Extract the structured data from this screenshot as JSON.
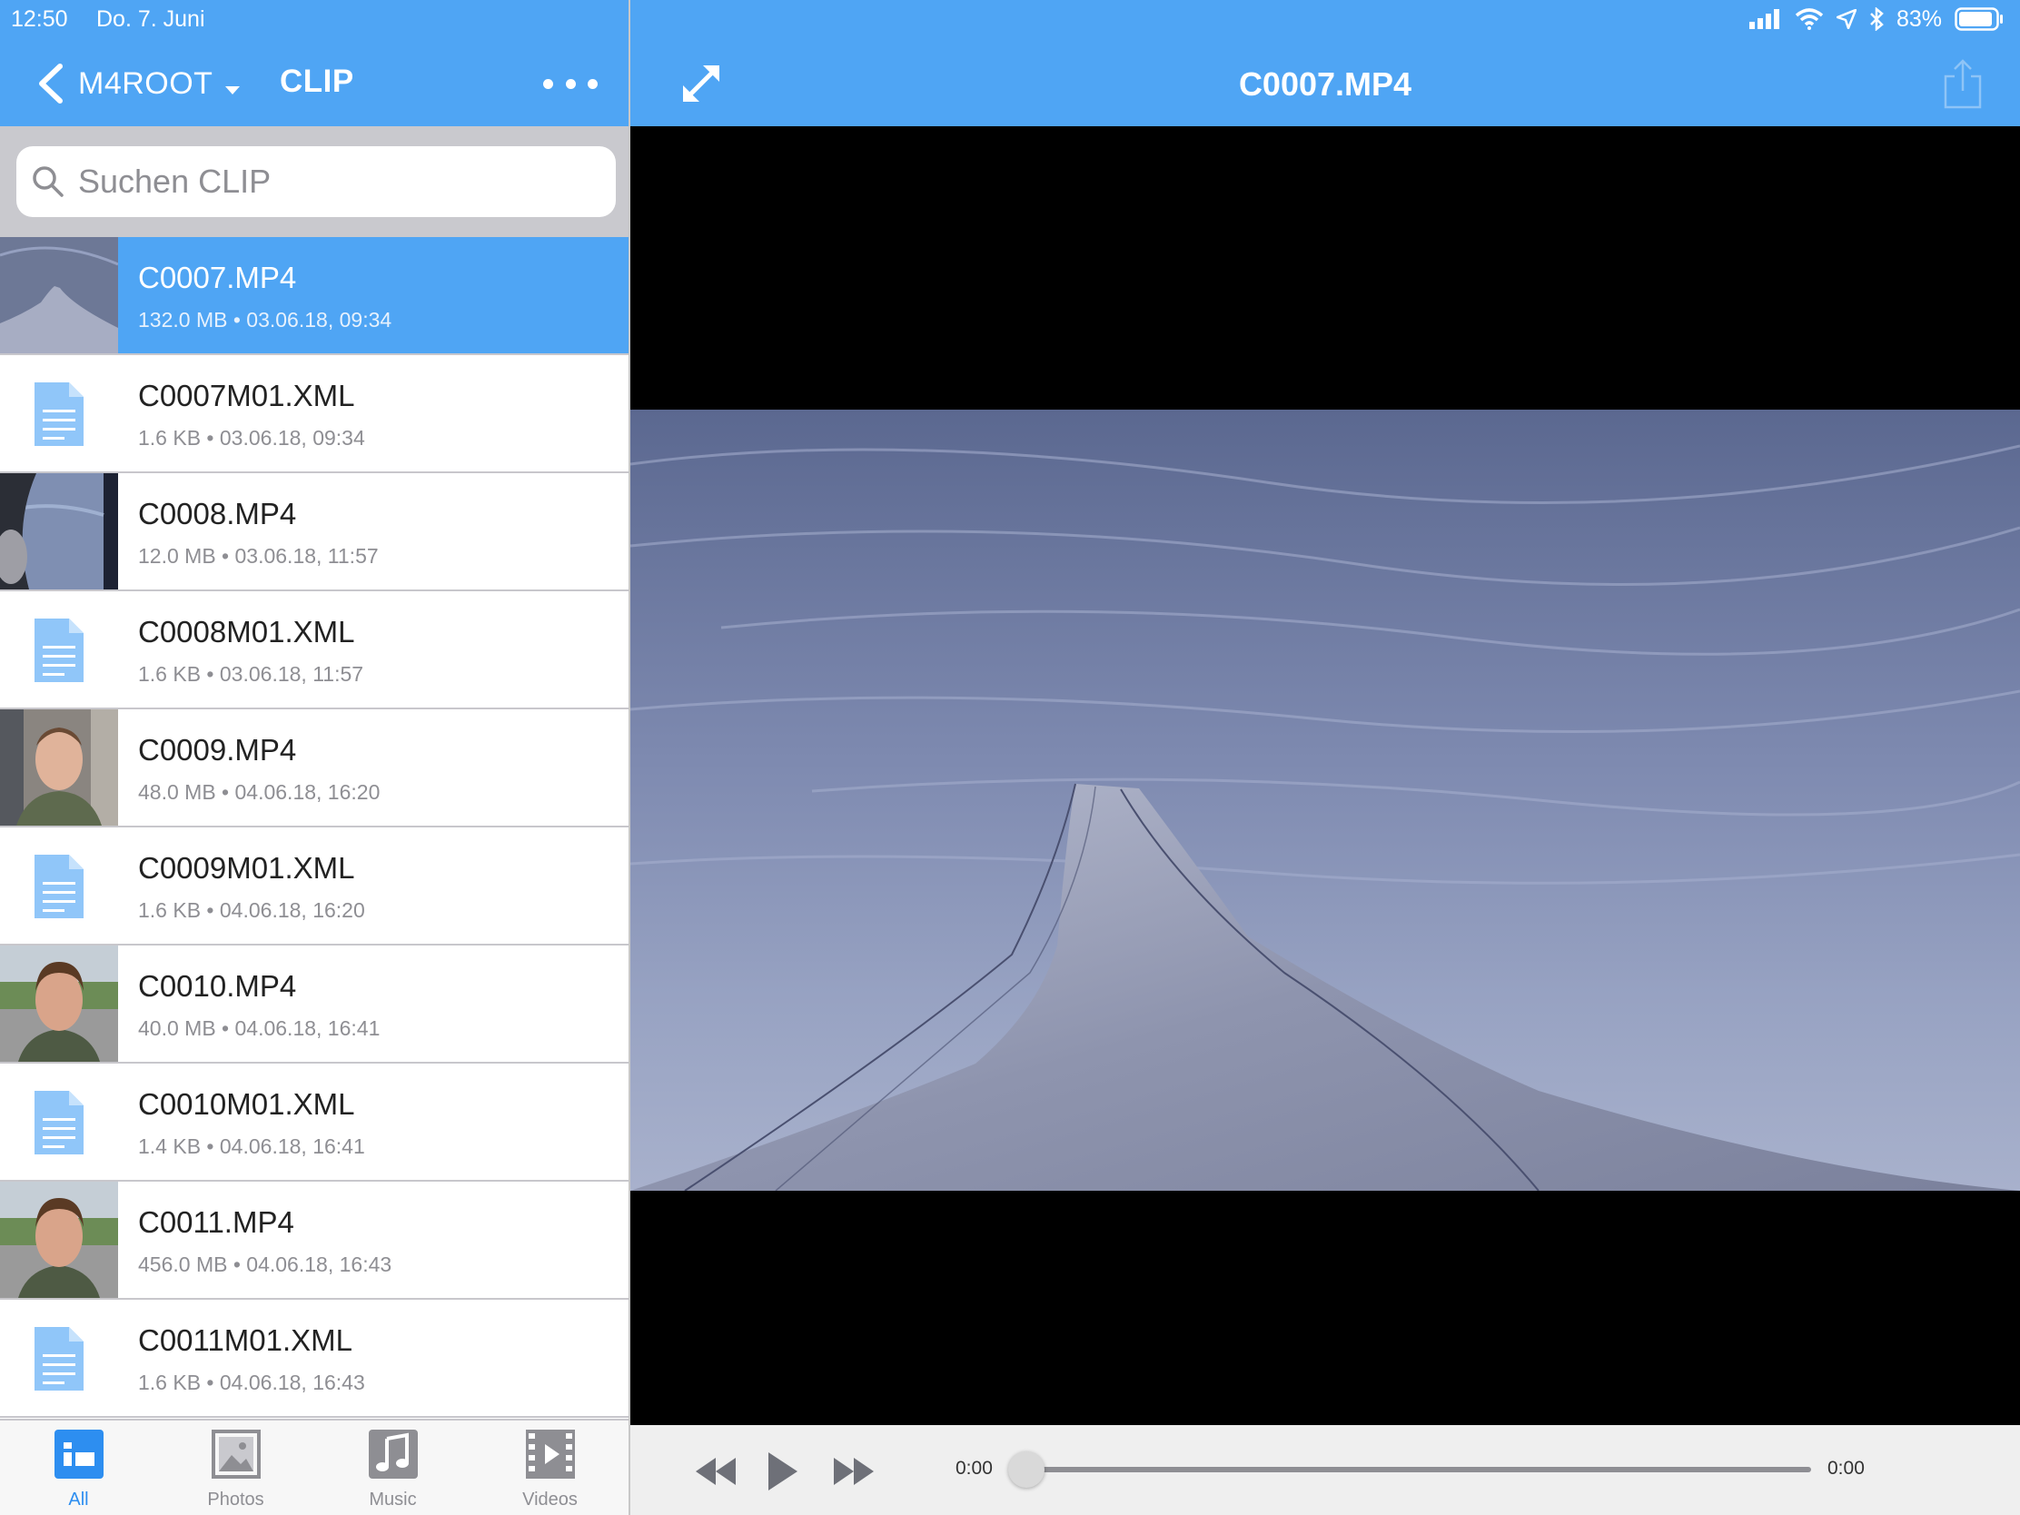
{
  "status": {
    "time": "12:50",
    "date": "Do. 7. Juni",
    "battery": "83%"
  },
  "browser": {
    "back_label": "M4ROOT",
    "folder_title": "CLIP",
    "search_placeholder": "Suchen CLIP",
    "files": [
      {
        "name": "C0007.MP4",
        "size": "132.0 MB",
        "date": "03.06.18, 09:34",
        "kind": "video-wing",
        "selected": true
      },
      {
        "name": "C0007M01.XML",
        "size": "1.6 KB",
        "date": "03.06.18, 09:34",
        "kind": "doc"
      },
      {
        "name": "C0008.MP4",
        "size": "12.0 MB",
        "date": "03.06.18, 11:57",
        "kind": "video-window"
      },
      {
        "name": "C0008M01.XML",
        "size": "1.6 KB",
        "date": "03.06.18, 11:57",
        "kind": "doc"
      },
      {
        "name": "C0009.MP4",
        "size": "48.0 MB",
        "date": "04.06.18, 16:20",
        "kind": "video-face-indoor"
      },
      {
        "name": "C0009M01.XML",
        "size": "1.6 KB",
        "date": "04.06.18, 16:20",
        "kind": "doc"
      },
      {
        "name": "C0010.MP4",
        "size": "40.0 MB",
        "date": "04.06.18, 16:41",
        "kind": "video-face-outdoor"
      },
      {
        "name": "C0010M01.XML",
        "size": "1.4 KB",
        "date": "04.06.18, 16:41",
        "kind": "doc"
      },
      {
        "name": "C0011.MP4",
        "size": "456.0 MB",
        "date": "04.06.18, 16:43",
        "kind": "video-face-outdoor"
      },
      {
        "name": "C0011M01.XML",
        "size": "1.6 KB",
        "date": "04.06.18, 16:43",
        "kind": "doc"
      }
    ],
    "tabs": [
      {
        "label": "All",
        "icon": "all-icon",
        "active": true
      },
      {
        "label": "Photos",
        "icon": "photos-icon"
      },
      {
        "label": "Music",
        "icon": "music-icon"
      },
      {
        "label": "Videos",
        "icon": "videos-icon"
      }
    ]
  },
  "player": {
    "title": "C0007.MP4",
    "current_time": "0:00",
    "total_time": "0:00",
    "progress": 0
  },
  "colors": {
    "accent": "#4fa5f4",
    "active_tab": "#2d8ef0"
  }
}
